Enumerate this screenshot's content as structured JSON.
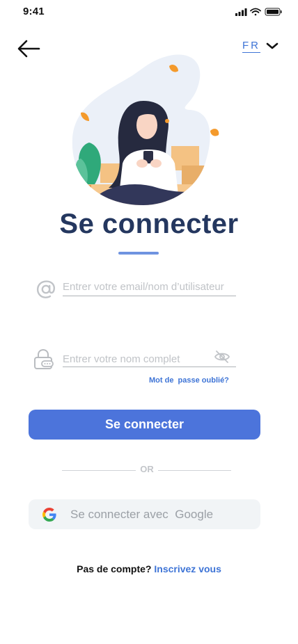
{
  "status_bar": {
    "time": "9:41"
  },
  "header": {
    "language": "FR"
  },
  "title": "Se connecter",
  "email_field": {
    "placeholder": "Entrer votre email/nom d’utilisateur"
  },
  "password_field": {
    "placeholder": "Entrer votre nom complet"
  },
  "forgot_password": "Mot de  passe oublié?",
  "login_button": "Se connecter",
  "divider": "OR",
  "google_button": "Se connecter avec  Google",
  "footer": {
    "text": "Pas de compte? ",
    "link": "Inscrivez vous"
  },
  "colors": {
    "accent": "#4C74DB",
    "title": "#24375F",
    "link": "#3E74D6"
  }
}
